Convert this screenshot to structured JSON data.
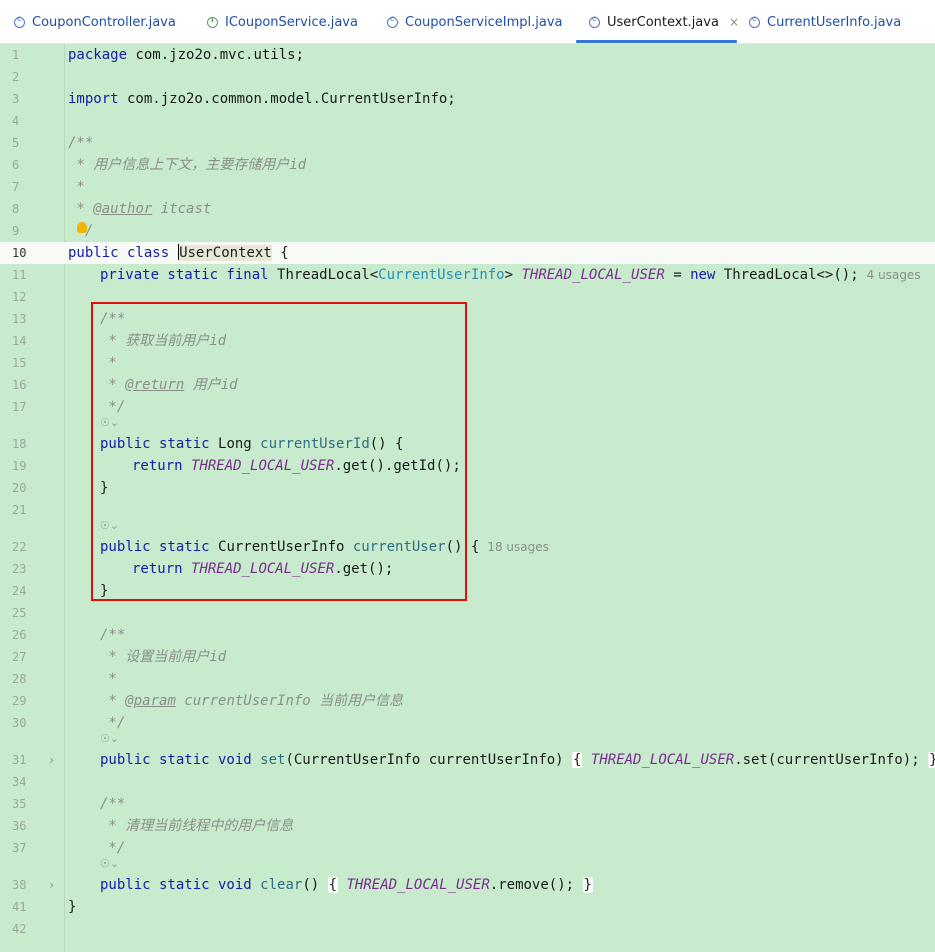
{
  "tabs": [
    {
      "label": "CouponController.java",
      "icon": "class-icon"
    },
    {
      "label": "ICouponService.java",
      "icon": "interface-icon"
    },
    {
      "label": "CouponServiceImpl.java",
      "icon": "class-icon"
    },
    {
      "label": "UserContext.java",
      "icon": "class-icon",
      "active": true
    },
    {
      "label": "CurrentUserInfo.java",
      "icon": "class-icon"
    }
  ],
  "tab_close_glyph": "×",
  "colors": {
    "editor_bg": "#c7ebcc",
    "highlight_box": "#e01010",
    "active_tab_underline": "#3874d8"
  },
  "code": {
    "l1_kw": "package",
    "l1_rest": " com.jzo2o.mvc.utils;",
    "l3_kw": "import",
    "l3_rest": " com.jzo2o.common.model.CurrentUserInfo;",
    "l5": "/**",
    "l6": " * 用户信息上下文，主要存储用户id",
    "l7": " *",
    "l8_pre": " * ",
    "l8_tag": "@author",
    "l8_post": " itcast",
    "l9": " */",
    "l10_kw": "public class ",
    "l10_name": "UserContext",
    "l10_post": " {",
    "l11_kw": "private static final ",
    "l11_t1": "ThreadLocal<",
    "l11_t2": "CurrentUserInfo",
    "l11_t3": "> ",
    "l11_const": "THREAD_LOCAL_USER",
    "l11_eq": " = ",
    "l11_new": "new",
    "l11_end": " ThreadLocal<>();",
    "l11_hint": "4 usages",
    "l13": "/**",
    "l14": " * 获取当前用户id",
    "l15": " *",
    "l16_pre": " * ",
    "l16_tag": "@return",
    "l16_post": " 用户id",
    "l17": " */",
    "l18_kw": "public static ",
    "l18_t": "Long ",
    "l18_m": "currentUserId",
    "l18_end": "() {",
    "l19_kw": "return ",
    "l19_const": "THREAD_LOCAL_USER",
    "l19_end": ".get().getId();",
    "l20": "}",
    "l22_kw": "public static ",
    "l22_t": "CurrentUserInfo ",
    "l22_m": "currentUser",
    "l22_end": "() {",
    "l22_hint": "18 usages",
    "l23_kw": "return ",
    "l23_const": "THREAD_LOCAL_USER",
    "l23_end": ".get();",
    "l24": "}",
    "l26": "/**",
    "l27": " * 设置当前用户id",
    "l28": " *",
    "l29_pre": " * ",
    "l29_tag": "@param",
    "l29_post": " currentUserInfo 当前用户信息",
    "l30": " */",
    "l31_kw": "public static void ",
    "l31_m": "set",
    "l31_mid": "(CurrentUserInfo currentUserInfo) ",
    "l31_ob": "{",
    "l31_const": "THREAD_LOCAL_USER",
    "l31_end": ".set(currentUserInfo);",
    "l31_cb": "}",
    "l35": "/**",
    "l36": " * 清理当前线程中的用户信息",
    "l37": " */",
    "l38_kw": "public static void ",
    "l38_m": "clear",
    "l38_mid": "() ",
    "l38_ob": "{",
    "l38_const": "THREAD_LOCAL_USER",
    "l38_end": ".remove();",
    "l38_cb": "}",
    "l41": "}"
  },
  "line_numbers": {
    "a": "1",
    "b": "2",
    "c": "3",
    "d": "4",
    "e": "5",
    "f": "6",
    "g": "7",
    "h": "8",
    "i": "9",
    "j": "10",
    "k": "11",
    "l": "12",
    "m": "13",
    "n": "14",
    "o": "15",
    "p": "16",
    "q": "17",
    "r": "18",
    "s": "19",
    "t": "20",
    "u": "21",
    "v": "22",
    "w": "23",
    "x": "24",
    "y": "25",
    "z": "26",
    "aa": "27",
    "ab": "28",
    "ac": "29",
    "ad": "30",
    "ae": "31",
    "af": "34",
    "ag": "35",
    "ah": "36",
    "ai": "37",
    "aj": "38",
    "ak": "41",
    "al": "42"
  },
  "fold_glyph": "›",
  "ai_glyph": "☉⌄"
}
